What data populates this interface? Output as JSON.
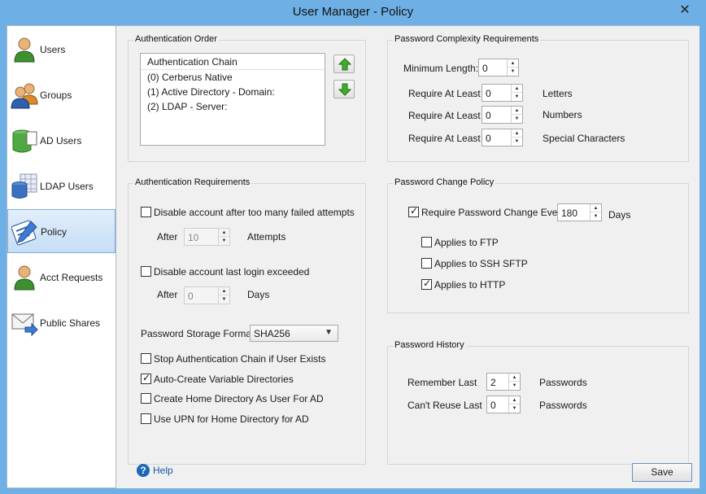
{
  "window": {
    "title": "User Manager - Policy",
    "close_glyph": "✕"
  },
  "sidebar": {
    "items": [
      {
        "label": "Users",
        "icon": "user-icon"
      },
      {
        "label": "Groups",
        "icon": "groups-icon"
      },
      {
        "label": "AD Users",
        "icon": "database-icon"
      },
      {
        "label": "LDAP Users",
        "icon": "ldap-database-icon"
      },
      {
        "label": "Policy",
        "icon": "policy-icon",
        "selected": true
      },
      {
        "label": "Acct Requests",
        "icon": "user-request-icon"
      },
      {
        "label": "Public Shares",
        "icon": "envelope-icon"
      }
    ]
  },
  "auth_order": {
    "title": "Authentication Order",
    "header": "Authentication Chain",
    "items": [
      "(0) Cerberus Native",
      "(1) Active Directory - Domain:",
      "(2) LDAP - Server:"
    ]
  },
  "auth_requirements": {
    "title": "Authentication Requirements",
    "disable_failed": {
      "label": "Disable account after too many failed attempts",
      "checked": false
    },
    "failed_after_label": "After",
    "failed_after_value": "10",
    "failed_units": "Attempts",
    "disable_last_login": {
      "label": "Disable account last login exceeded",
      "checked": false
    },
    "login_after_label": "After",
    "login_after_value": "0",
    "login_units": "Days",
    "storage_format_label": "Password Storage Format:",
    "storage_format_value": "SHA256",
    "stop_chain": {
      "label": "Stop Authentication Chain if User Exists",
      "checked": false
    },
    "auto_create": {
      "label": "Auto-Create Variable Directories",
      "checked": true
    },
    "create_home": {
      "label": "Create Home Directory As User For AD",
      "checked": false
    },
    "use_upn": {
      "label": "Use UPN for Home Directory for AD",
      "checked": false
    }
  },
  "complexity": {
    "title": "Password Complexity Requirements",
    "min_length_label": "Minimum Length:",
    "min_length_value": "0",
    "rows": [
      {
        "label": "Require At Least",
        "value": "0",
        "unit": "Letters"
      },
      {
        "label": "Require At Least",
        "value": "0",
        "unit": "Numbers"
      },
      {
        "label": "Require At Least",
        "value": "0",
        "unit": "Special Characters"
      }
    ]
  },
  "change_policy": {
    "title": "Password Change Policy",
    "require_change": {
      "label": "Require Password Change Every",
      "checked": true
    },
    "days_value": "180",
    "days_unit": "Days",
    "ftp": {
      "label": "Applies to FTP",
      "checked": false
    },
    "ssh": {
      "label": "Applies to SSH SFTP",
      "checked": false
    },
    "http": {
      "label": "Applies to HTTP",
      "checked": true
    }
  },
  "history": {
    "title": "Password History",
    "remember_label": "Remember Last",
    "remember_value": "2",
    "remember_unit": "Passwords",
    "reuse_label": "Can't Reuse Last",
    "reuse_value": "0",
    "reuse_unit": "Passwords"
  },
  "footer": {
    "help_glyph": "?",
    "help_label": "Help",
    "save_label": "Save"
  },
  "colors": {
    "window_frame": "#6eb0e6",
    "panel_bg": "#f0f0f0",
    "selected_nav": "#c6def6",
    "arrow_green": "#3fae2a"
  }
}
